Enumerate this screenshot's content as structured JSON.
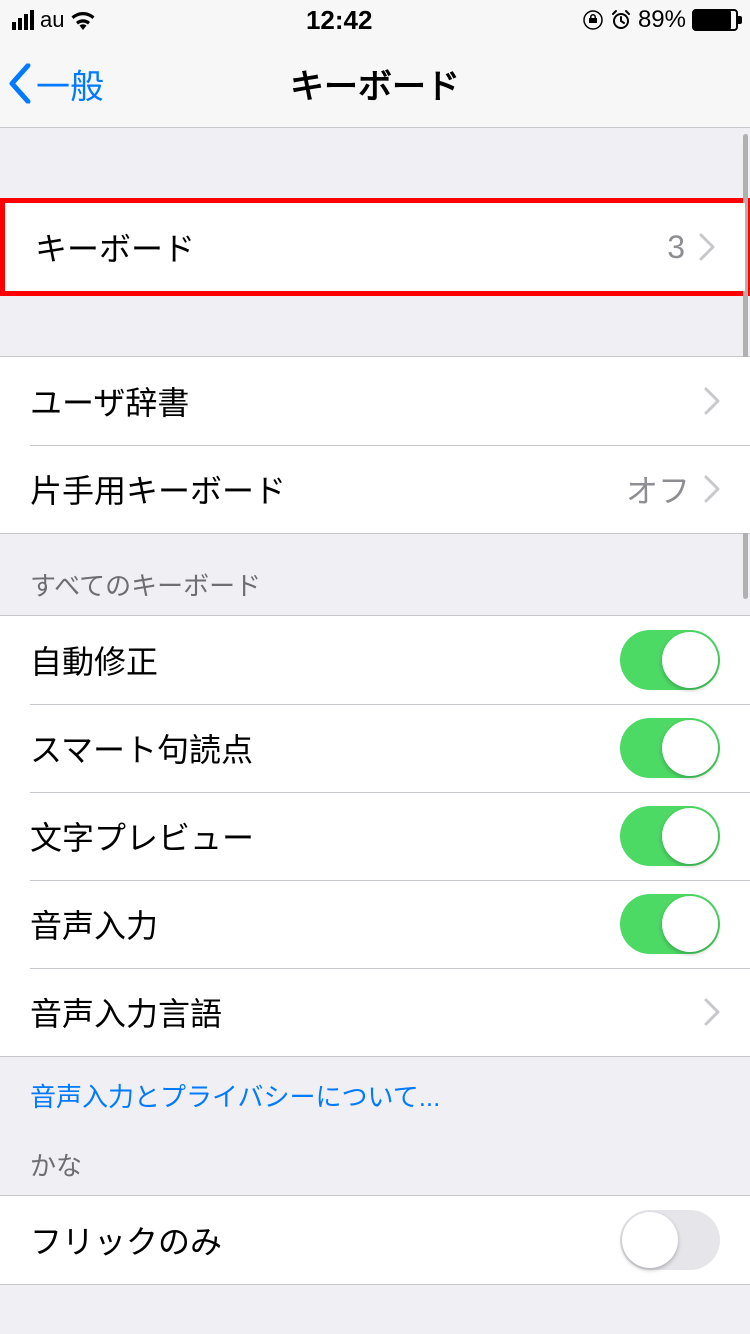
{
  "status": {
    "carrier": "au",
    "time": "12:42",
    "battery_pct": "89%"
  },
  "nav": {
    "back_label": "一般",
    "title": "キーボード"
  },
  "rows": {
    "keyboards": {
      "label": "キーボード",
      "value": "3"
    },
    "user_dict": {
      "label": "ユーザ辞書"
    },
    "one_handed": {
      "label": "片手用キーボード",
      "value": "オフ"
    }
  },
  "section_all_keyboards": {
    "header": "すべてのキーボード",
    "auto_correct": {
      "label": "自動修正",
      "on": true
    },
    "smart_punct": {
      "label": "スマート句読点",
      "on": true
    },
    "char_preview": {
      "label": "文字プレビュー",
      "on": true
    },
    "dictation": {
      "label": "音声入力",
      "on": true
    },
    "dictation_lang": {
      "label": "音声入力言語"
    },
    "footer_link": "音声入力とプライバシーについて..."
  },
  "section_kana": {
    "header": "かな",
    "flick_only": {
      "label": "フリックのみ",
      "on": false
    }
  }
}
